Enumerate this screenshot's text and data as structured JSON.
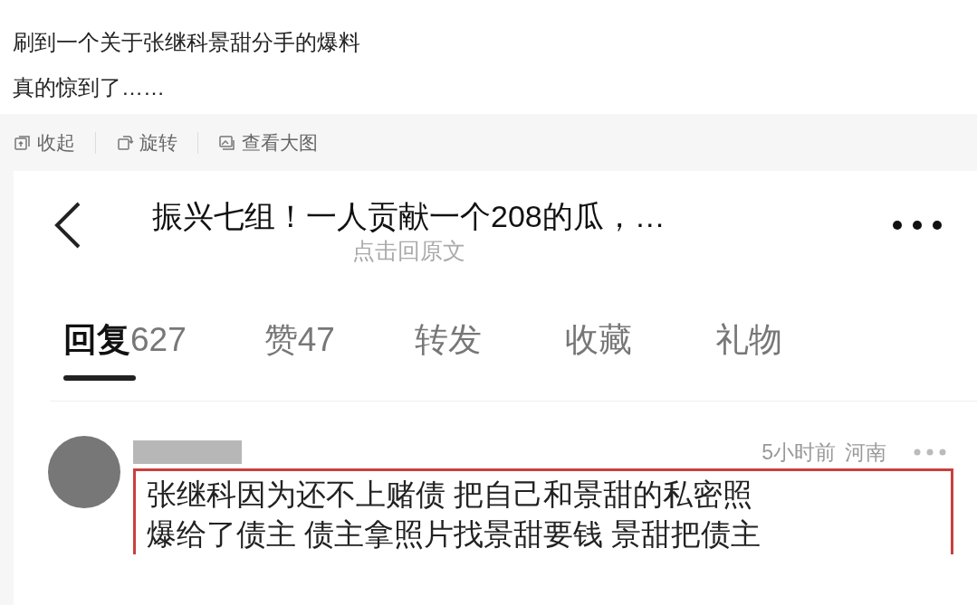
{
  "post": {
    "lines": [
      "刷到一个关于张继科景甜分手的爆料",
      "真的惊到了……"
    ]
  },
  "toolbar": [
    {
      "kind": "collapse",
      "label": "收起"
    },
    {
      "kind": "rotate",
      "label": "旋转"
    },
    {
      "kind": "image",
      "label": "查看大图"
    }
  ],
  "screenshot": {
    "title": "振兴七组！一人贡献一个208的瓜，…",
    "subtitle": "点击回原文",
    "tabs": [
      {
        "label": "回复",
        "count": "627",
        "selected": true
      },
      {
        "label": "赞",
        "count": "47",
        "selected": false
      },
      {
        "label": "转发",
        "selected": false
      },
      {
        "label": "收藏",
        "selected": false
      },
      {
        "label": "礼物",
        "selected": false
      }
    ],
    "comment": {
      "time": "5小时前",
      "location": "河南",
      "lines": [
        "张继科因为还不上赌债 把自己和景甜的私密照",
        "爆给了债主 债主拿照片找景甜要钱 景甜把债主"
      ]
    }
  }
}
